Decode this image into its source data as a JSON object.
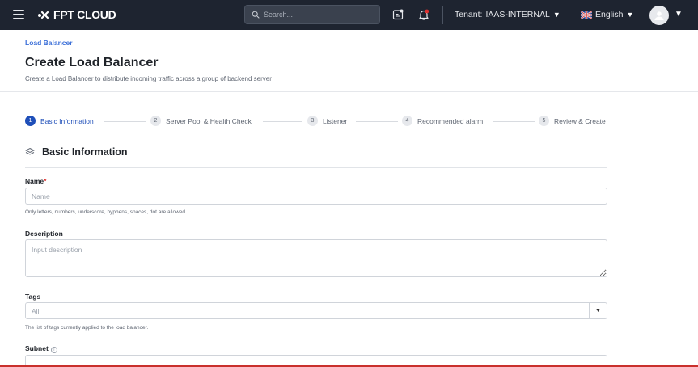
{
  "topbar": {
    "logo_text": "FPT CLOUD",
    "search_placeholder": "Search...",
    "tenant_label": "Tenant:",
    "tenant_value": "IAAS-INTERNAL",
    "language": "English"
  },
  "header": {
    "breadcrumb": "Load Balancer",
    "title": "Create Load Balancer",
    "subtitle": "Create a Load Balancer to distribute incoming traffic across a group of backend server"
  },
  "steps": [
    {
      "num": "1",
      "label": "Basic Information"
    },
    {
      "num": "2",
      "label": "Server Pool & Health Check"
    },
    {
      "num": "3",
      "label": "Listener"
    },
    {
      "num": "4",
      "label": "Recommended alarm"
    },
    {
      "num": "5",
      "label": "Review & Create"
    }
  ],
  "section": {
    "title": "Basic Information"
  },
  "form": {
    "name_label": "Name",
    "name_required": "*",
    "name_placeholder": "Name",
    "name_hint": "Only letters, numbers, underscore, hyphens, spaces, dot are allowed.",
    "description_label": "Description",
    "description_placeholder": "Input description",
    "tags_label": "Tags",
    "tags_value": "All",
    "tags_hint": "The list of tags currently applied to the load balancer.",
    "subnet_label": "Subnet"
  },
  "colors": {
    "accent": "#1f4fb9",
    "topbar": "#1e2430",
    "required": "#e0312f"
  }
}
